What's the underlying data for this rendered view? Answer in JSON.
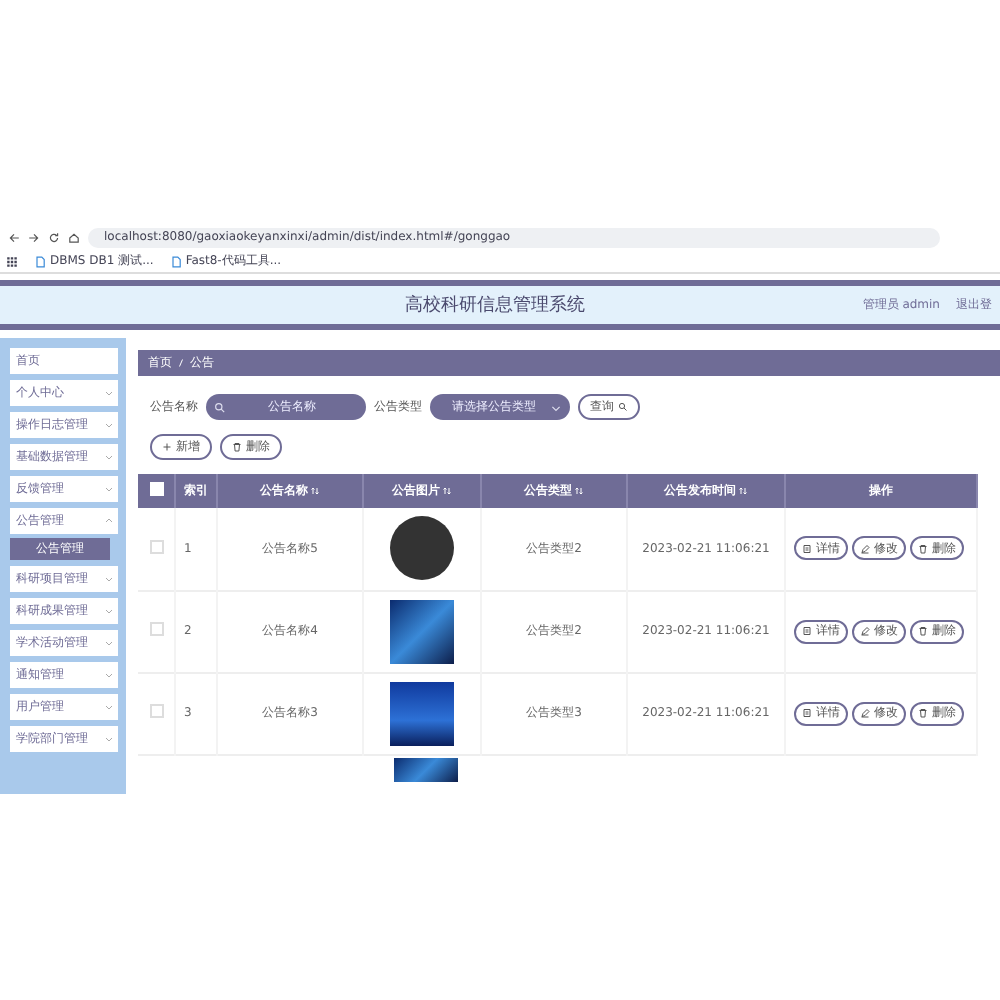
{
  "browser": {
    "url": "localhost:8080/gaoxiaokeyanxinxi/admin/dist/index.html#/gonggao",
    "bookmarks": [
      "DBMS DB1 测试...",
      "Fast8-代码工具..."
    ]
  },
  "header": {
    "title": "高校科研信息管理系统",
    "user": "管理员 admin",
    "logout": "退出登"
  },
  "sidebar": [
    {
      "label": "首页",
      "kind": "link"
    },
    {
      "label": "个人中心",
      "kind": "group",
      "expanded": false
    },
    {
      "label": "操作日志管理",
      "kind": "group",
      "expanded": false
    },
    {
      "label": "基础数据管理",
      "kind": "group",
      "expanded": false
    },
    {
      "label": "反馈管理",
      "kind": "group",
      "expanded": false
    },
    {
      "label": "公告管理",
      "kind": "group",
      "expanded": true,
      "children": [
        {
          "label": "公告管理",
          "selected": true
        }
      ]
    },
    {
      "label": "科研项目管理",
      "kind": "group",
      "expanded": false
    },
    {
      "label": "科研成果管理",
      "kind": "group",
      "expanded": false
    },
    {
      "label": "学术活动管理",
      "kind": "group",
      "expanded": false
    },
    {
      "label": "通知管理",
      "kind": "group",
      "expanded": false
    },
    {
      "label": "用户管理",
      "kind": "group",
      "expanded": false
    },
    {
      "label": "学院部门管理",
      "kind": "group",
      "expanded": false
    }
  ],
  "breadcrumb": [
    "首页",
    "公告"
  ],
  "search": {
    "name_label": "公告名称",
    "name_placeholder": "公告名称",
    "type_label": "公告类型",
    "type_placeholder": "请选择公告类型",
    "query_button": "查询"
  },
  "actions": [
    {
      "kind": "add",
      "label": "新增"
    },
    {
      "kind": "delete",
      "label": "删除"
    }
  ],
  "table": {
    "all_checked": false,
    "columns": [
      "索引",
      "公告名称",
      "公告图片",
      "公告类型",
      "公告发布时间",
      "操作"
    ],
    "rows": [
      {
        "index": "1",
        "name": "公告名称5",
        "type": "公告类型2",
        "time": "2023-02-21 11:06:21",
        "checked": false,
        "buttons": [
          {
            "kind": "detail",
            "label": "详情"
          },
          {
            "kind": "edit",
            "label": "修改"
          },
          {
            "kind": "delete",
            "label": "删除"
          }
        ]
      },
      {
        "index": "2",
        "name": "公告名称4",
        "type": "公告类型2",
        "time": "2023-02-21 11:06:21",
        "checked": false,
        "buttons": [
          {
            "kind": "detail",
            "label": "详情"
          },
          {
            "kind": "edit",
            "label": "修改"
          },
          {
            "kind": "delete",
            "label": "删除"
          }
        ]
      },
      {
        "index": "3",
        "name": "公告名称3",
        "type": "公告类型3",
        "time": "2023-02-21 11:06:21",
        "checked": false,
        "buttons": [
          {
            "kind": "detail",
            "label": "详情"
          },
          {
            "kind": "edit",
            "label": "修改"
          },
          {
            "kind": "delete",
            "label": "删除"
          }
        ]
      }
    ]
  }
}
